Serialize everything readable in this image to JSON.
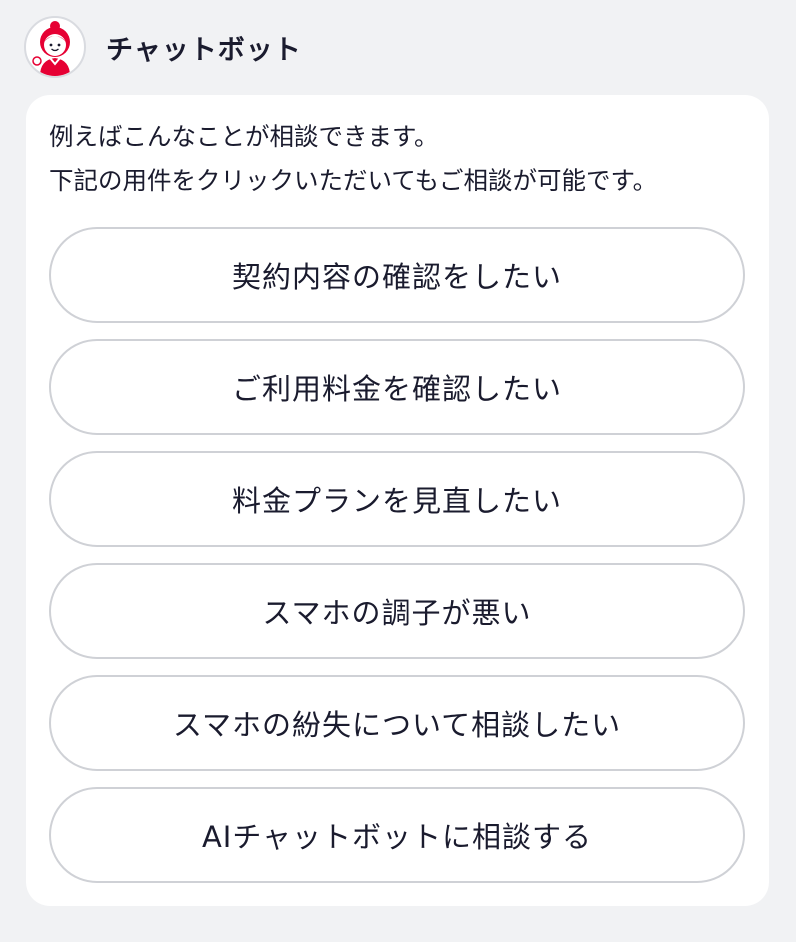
{
  "header": {
    "avatar_icon": "chatbot-girl-mascot-icon",
    "bot_name": "チャットボット"
  },
  "message": {
    "line1": "例えばこんなことが相談できます。",
    "line2": "下記の用件をクリックいただいてもご相談が可能です。"
  },
  "options": [
    {
      "label": "契約内容の確認をしたい"
    },
    {
      "label": "ご利用料金を確認したい"
    },
    {
      "label": "料金プランを見直したい"
    },
    {
      "label": "スマホの調子が悪い"
    },
    {
      "label": "スマホの紛失について相談したい"
    },
    {
      "label": "AIチャットボットに相談する"
    }
  ],
  "colors": {
    "background": "#f1f2f4",
    "card": "#ffffff",
    "text": "#1a1b2e",
    "accent_red": "#e60033",
    "button_border": "#cfd1d6"
  }
}
